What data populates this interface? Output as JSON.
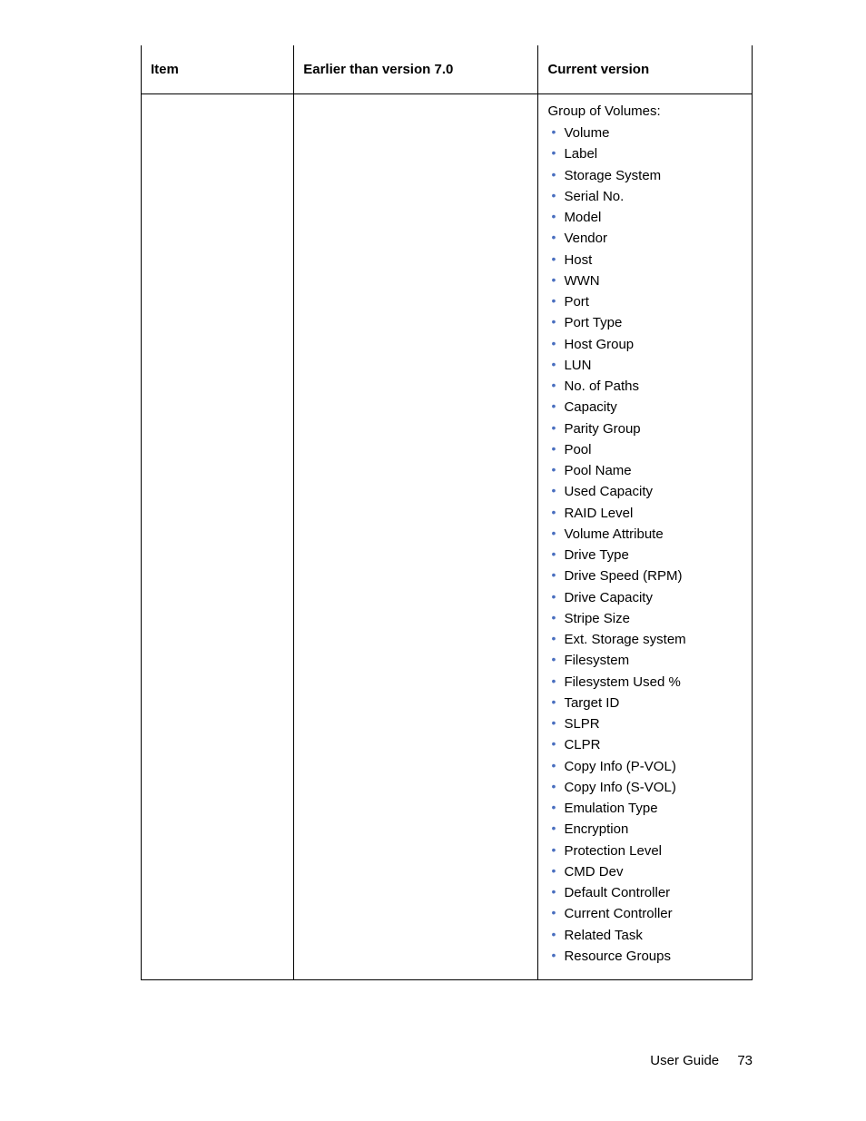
{
  "table": {
    "headers": {
      "item": "Item",
      "earlier": "Earlier than version 7.0",
      "current": "Current version"
    },
    "row": {
      "item": "",
      "earlier": "",
      "current": {
        "section": "Group of Volumes:",
        "items": [
          "Volume",
          "Label",
          "Storage System",
          "Serial No.",
          "Model",
          "Vendor",
          "Host",
          "WWN",
          "Port",
          "Port Type",
          "Host Group",
          "LUN",
          "No. of Paths",
          "Capacity",
          "Parity Group",
          "Pool",
          "Pool Name",
          "Used Capacity",
          "RAID Level",
          "Volume Attribute",
          "Drive Type",
          "Drive Speed (RPM)",
          "Drive Capacity",
          "Stripe Size",
          "Ext. Storage system",
          "Filesystem",
          "Filesystem Used %",
          "Target ID",
          "SLPR",
          "CLPR",
          "Copy Info (P-VOL)",
          "Copy Info (S-VOL)",
          "Emulation Type",
          "Encryption",
          "Protection Level",
          "CMD Dev",
          "Default Controller",
          "Current Controller",
          "Related Task",
          "Resource Groups"
        ]
      }
    }
  },
  "footer": {
    "label": "User Guide",
    "page": "73"
  }
}
